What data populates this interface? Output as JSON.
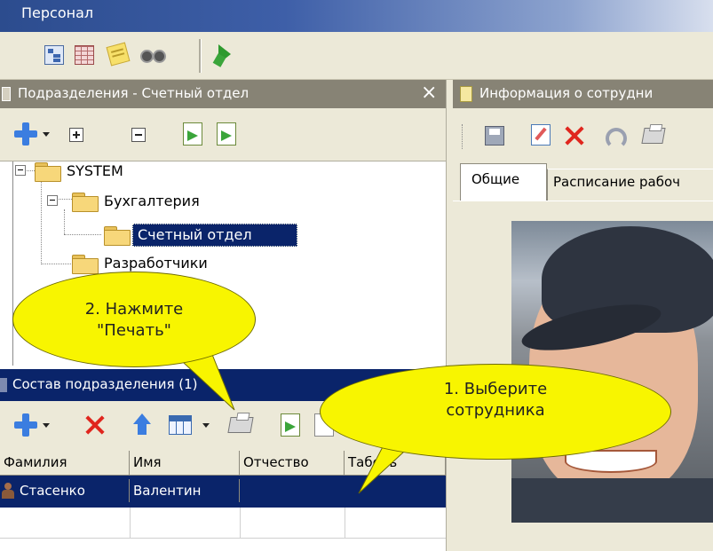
{
  "window": {
    "title": "Персонал"
  },
  "dept_panel": {
    "title": "Подразделения - Счетный отдел",
    "close_glyph": "×",
    "tree": [
      {
        "label": "SYSTEM"
      },
      {
        "label": "Бухгалтерия"
      },
      {
        "label": "Счетный отдел",
        "selected": true
      },
      {
        "label": "Разработчики"
      }
    ]
  },
  "info_panel": {
    "title": "Информация о сотрудни",
    "tabs": [
      {
        "label": "Общие",
        "active": true
      },
      {
        "label": "Расписание рабоч"
      }
    ]
  },
  "staff_panel": {
    "title": "Состав подразделения (1)",
    "columns": [
      "Фамилия",
      "Имя",
      "Отчество",
      "Табель"
    ],
    "rows": [
      {
        "last_name": "Стасенко",
        "first_name": "Валентин",
        "patronymic": "",
        "tabel": "",
        "selected": true
      }
    ]
  },
  "callouts": {
    "print_hint": "2. Нажмите \"Печать\"",
    "select_hint": "1. Выберите сотрудника"
  },
  "colors": {
    "title_bar": "#2c4c8e",
    "panel_header_inactive": "#878375",
    "panel_header_active": "#0a246a",
    "selection": "#0a246a",
    "callout": "#f8f500"
  },
  "icons": [
    "tree-view-icon",
    "grid-view-icon",
    "notes-icon",
    "binoculars-icon",
    "run-icon",
    "add-icon",
    "expand-all-icon",
    "collapse-all-icon",
    "import-icon",
    "export-icon",
    "save-icon",
    "edit-icon",
    "delete-icon",
    "undo-icon",
    "print-icon",
    "move-up-icon",
    "columns-icon",
    "employee-icon",
    "folder-icon"
  ]
}
